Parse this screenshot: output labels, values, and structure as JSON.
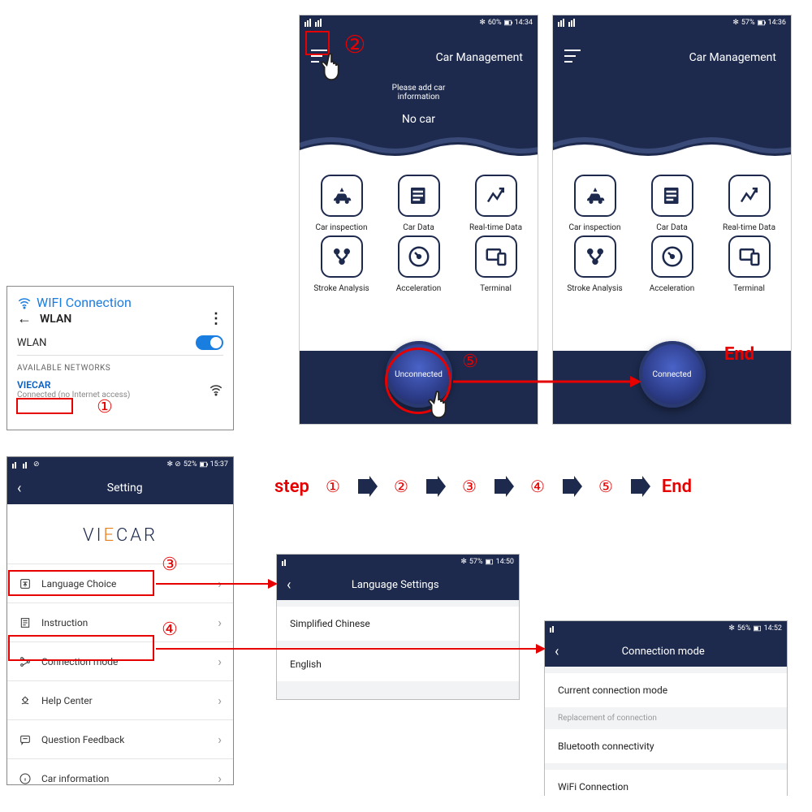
{
  "annotations": {
    "steps": [
      "①",
      "②",
      "③",
      "④",
      "⑤"
    ],
    "step_label": "step",
    "end_label": "End"
  },
  "wifi_panel": {
    "title": "WIFI Connection",
    "back_label": "WLAN",
    "toggle_label": "WLAN",
    "available_header": "AVAILABLE NETWORKS",
    "network_name": "VIECAR",
    "network_status": "Connected (no Internet access)"
  },
  "car_app": {
    "statusbars": {
      "left": {
        "battery": "60%",
        "time": "14:34"
      },
      "right": {
        "battery": "57%",
        "time": "14:36"
      }
    },
    "title": "Car Management",
    "please": "Please add car\ninformation",
    "nocar": "No car",
    "grid": [
      "Car inspection",
      "Car Data",
      "Real-time Data",
      "Stroke Analysis",
      "Acceleration",
      "Terminal"
    ],
    "conn": {
      "unconnected": "Unconnected",
      "connected": "Connected"
    }
  },
  "settings": {
    "statusbar": {
      "battery": "52%",
      "time": "15:37"
    },
    "title": "Setting",
    "brand": "VIECAR",
    "items": [
      "Language Choice",
      "Instruction",
      "Connection mode",
      "Help Center",
      "Question Feedback",
      "Car information"
    ]
  },
  "lang_panel": {
    "statusbar": {
      "battery": "57%",
      "time": "14:50"
    },
    "title": "Language Settings",
    "options": [
      "Simplified Chinese",
      "English"
    ]
  },
  "conn_panel": {
    "statusbar": {
      "battery": "56%",
      "time": "14:52"
    },
    "title": "Connection mode",
    "items": {
      "current": "Current connection mode",
      "subhead": "Replacement of connection",
      "bt": "Bluetooth connectivity",
      "wifi": "WiFi Connection"
    }
  }
}
